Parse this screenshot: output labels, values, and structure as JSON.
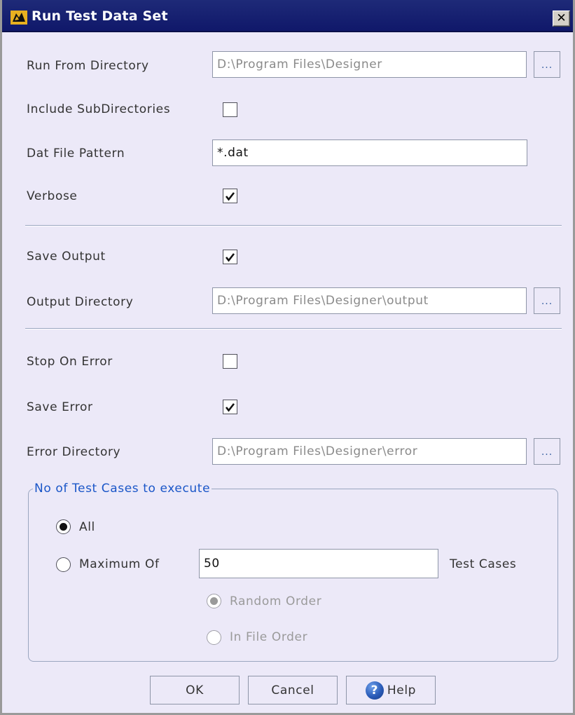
{
  "window": {
    "title": "Run Test Data Set",
    "close_glyph": "✕"
  },
  "fields": {
    "run_from_directory": {
      "label": "Run From Directory",
      "value": "D:\\Program Files\\Designer",
      "browse_label": "..."
    },
    "include_subdirectories": {
      "label": "Include SubDirectories",
      "checked": false
    },
    "dat_file_pattern": {
      "label": "Dat File Pattern",
      "value": "*.dat"
    },
    "verbose": {
      "label": "Verbose",
      "checked": true
    },
    "save_output": {
      "label": "Save Output",
      "checked": true
    },
    "output_directory": {
      "label": "Output Directory",
      "value": "D:\\Program Files\\Designer\\output",
      "browse_label": "..."
    },
    "stop_on_error": {
      "label": "Stop On Error",
      "checked": false
    },
    "save_error": {
      "label": "Save Error",
      "checked": true
    },
    "error_directory": {
      "label": "Error Directory",
      "value": "D:\\Program Files\\Designer\\error",
      "browse_label": "..."
    }
  },
  "test_cases_group": {
    "legend": "No of Test Cases to execute",
    "all": {
      "label": "All",
      "selected": true
    },
    "maximum": {
      "label": "Maximum Of",
      "selected": false,
      "value": "50",
      "suffix": "Test Cases"
    },
    "random_order": {
      "label": "Random Order",
      "selected": true,
      "disabled": true
    },
    "in_file_order": {
      "label": "In File Order",
      "selected": false,
      "disabled": true
    }
  },
  "buttons": {
    "ok": "OK",
    "cancel": "Cancel",
    "help": "Help",
    "help_icon_glyph": "?"
  },
  "colors": {
    "title_bar": "#10186a",
    "dialog_background": "#ece9f8",
    "group_legend": "#1a56c8",
    "disabled_text": "#9a9a9a"
  }
}
